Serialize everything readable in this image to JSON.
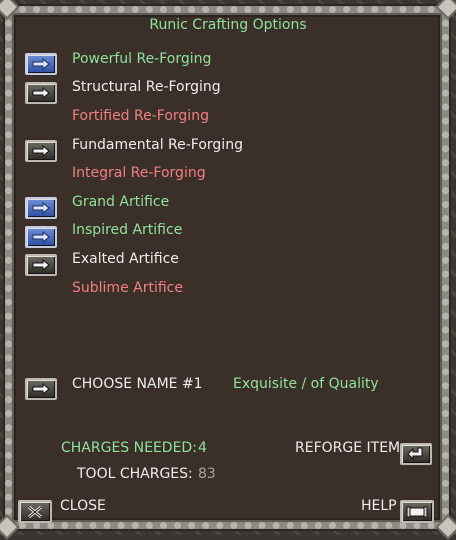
{
  "title": "Runic Crafting Options",
  "options": [
    {
      "label": "Powerful Re-Forging",
      "color": "#8fe39a",
      "button": "blue"
    },
    {
      "label": "Structural Re-Forging",
      "color": "#ededed",
      "button": "grey"
    },
    {
      "label": "Fortified Re-Forging",
      "color": "#f08080",
      "button": "none"
    },
    {
      "label": "Fundamental Re-Forging",
      "color": "#ededed",
      "button": "grey"
    },
    {
      "label": "Integral Re-Forging",
      "color": "#f08080",
      "button": "none"
    },
    {
      "label": "Grand Artifice",
      "color": "#8fe39a",
      "button": "blue"
    },
    {
      "label": "Inspired Artifice",
      "color": "#8fe39a",
      "button": "blue"
    },
    {
      "label": "Exalted Artifice",
      "color": "#ededed",
      "button": "grey"
    },
    {
      "label": "Sublime Artifice",
      "color": "#f08080",
      "button": "none"
    }
  ],
  "choose_name": {
    "label": "CHOOSE NAME #1",
    "value": "Exquisite / of Quality"
  },
  "charges_needed": {
    "label": "CHARGES NEEDED:",
    "value": "4"
  },
  "tool_charges": {
    "label": "TOOL CHARGES:",
    "value": "83"
  },
  "reforge": {
    "label": "REFORGE ITEM"
  },
  "close": {
    "label": "CLOSE"
  },
  "help": {
    "label": "HELP"
  }
}
